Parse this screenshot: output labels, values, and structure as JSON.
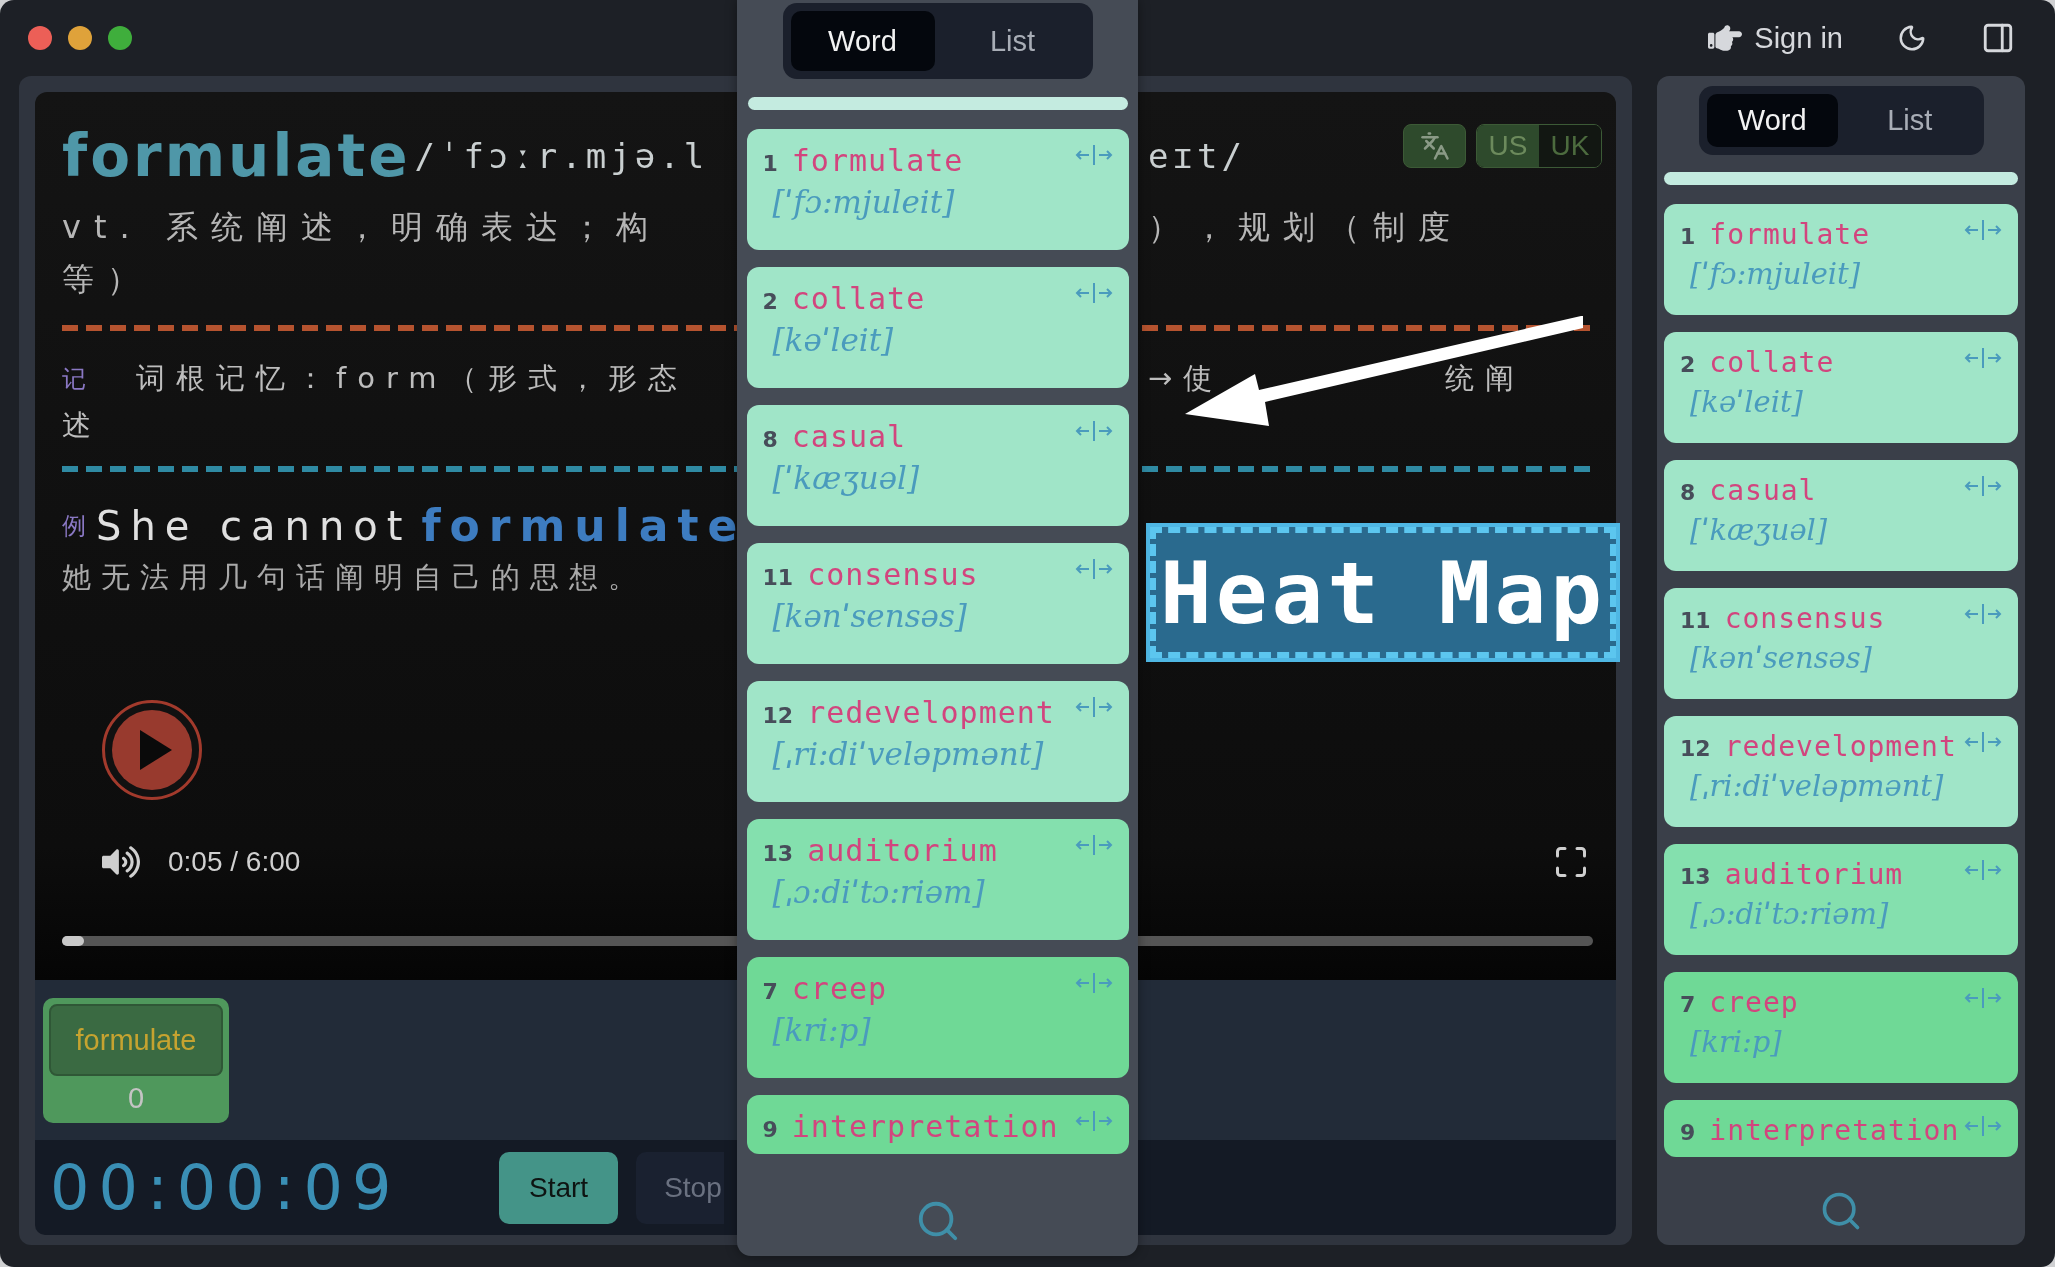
{
  "header": {
    "sign_in": "Sign in"
  },
  "player": {
    "headword": "formulate",
    "phonetic_left": "/ˈfɔːr.mjə.l",
    "phonetic_right": "eɪt/",
    "accents": [
      {
        "label": "US",
        "selected": true
      },
      {
        "label": "UK",
        "selected": false
      }
    ],
    "definition": {
      "left": "vt. 系统阐述，明确表达；构",
      "right": "），规划（制度",
      "continuation": "等）"
    },
    "mnemonic": {
      "tag": "记",
      "left": "词根记忆：form（形式，形态",
      "right_parts": [
        "→使",
        "统阐"
      ],
      "continuation": "述"
    },
    "example": {
      "tag": "例",
      "sentence_start": "She cannot",
      "highlight": "formulate",
      "translation": "她无法用几句话阐明自己的思想。"
    },
    "time": "0:05 / 6:00",
    "progress": {
      "level": 0.014
    }
  },
  "annotation": {
    "label": "Heat Map"
  },
  "practice": {
    "chip": {
      "word": "formulate",
      "count": "0"
    },
    "timer": "00:00:09",
    "buttons": [
      "Start",
      "Stop"
    ]
  },
  "floating_panel": {
    "tabs": [
      {
        "label": "Word",
        "selected": true
      },
      {
        "label": "List",
        "selected": false
      }
    ],
    "word_list": [
      {
        "number": "1",
        "word": "formulate",
        "phonetic": "[ˈfɔ:mjuleit]",
        "color": "#a0e5c8"
      },
      {
        "number": "2",
        "word": "collate",
        "phonetic": "[kəˈleit]",
        "color": "#a0e5c8"
      },
      {
        "number": "8",
        "word": "casual",
        "phonetic": "[ˈkæʒuəl]",
        "color": "#a0e5c8"
      },
      {
        "number": "11",
        "word": "consensus",
        "phonetic": "[kənˈsensəs]",
        "color": "#a0e5c8"
      },
      {
        "number": "12",
        "word": "redevelopment",
        "phonetic": "[ˌri:diˈveləpmənt]",
        "color": "#a0e5c8"
      },
      {
        "number": "13",
        "word": "auditorium",
        "phonetic": "[ˌɔ:diˈtɔ:riəm]",
        "color": "#84e0ae"
      },
      {
        "number": "7",
        "word": "creep",
        "phonetic": "[kri:p]",
        "color": "#6fd996"
      },
      {
        "number": "9",
        "word": "interpretation",
        "color": "#6fd996"
      }
    ]
  },
  "sidebar": {
    "tabs": [
      {
        "label": "Word",
        "selected": true
      },
      {
        "label": "List",
        "selected": false
      }
    ],
    "word_list": [
      {
        "number": "1",
        "word": "formulate",
        "phonetic": "[ˈfɔ:mjuleit]",
        "color": "#a0e5c8"
      },
      {
        "number": "2",
        "word": "collate",
        "phonetic": "[kəˈleit]",
        "color": "#a0e5c8"
      },
      {
        "number": "8",
        "word": "casual",
        "phonetic": "[ˈkæʒuəl]",
        "color": "#a0e5c8"
      },
      {
        "number": "11",
        "word": "consensus",
        "phonetic": "[kənˈsensəs]",
        "color": "#a0e5c8"
      },
      {
        "number": "12",
        "word": "redevelopment",
        "phonetic": "[ˌri:diˈveləpmənt]",
        "color": "#a0e5c8"
      },
      {
        "number": "13",
        "word": "auditorium",
        "phonetic": "[ˌɔ:diˈtɔ:riəm]",
        "color": "#84e0ae"
      },
      {
        "number": "7",
        "word": "creep",
        "phonetic": "[kri:p]",
        "color": "#6fd996"
      },
      {
        "number": "9",
        "word": "interpretation",
        "color": "#6fd996"
      }
    ]
  }
}
